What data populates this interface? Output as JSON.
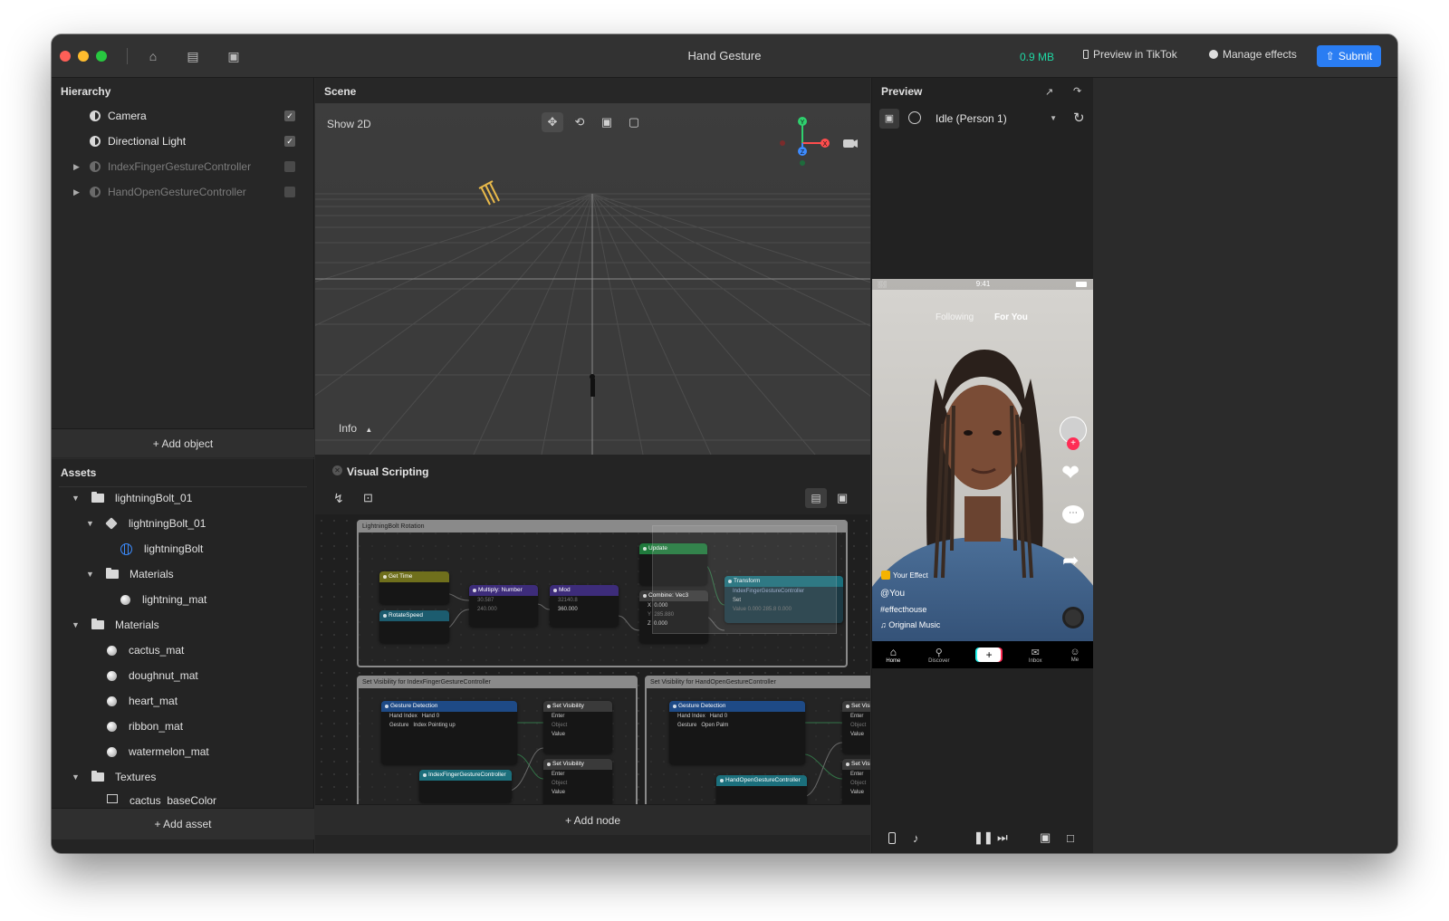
{
  "titlebar": {
    "title": "Hand Gesture",
    "memory": "0.9 MB",
    "preview_in_tiktok": "Preview in TikTok",
    "manage_effects": "Manage effects",
    "submit": "Submit"
  },
  "hierarchy": {
    "title": "Hierarchy",
    "items": [
      {
        "label": "Camera",
        "checked": true
      },
      {
        "label": "Directional Light",
        "checked": true
      },
      {
        "label": "IndexFingerGestureController",
        "checked": false
      },
      {
        "label": "HandOpenGestureController",
        "checked": false
      }
    ],
    "add_label": "+ Add object"
  },
  "assets": {
    "title": "Assets",
    "items": [
      {
        "label": "lightningBolt_01",
        "kind": "folder"
      },
      {
        "label": "lightningBolt_01",
        "kind": "model"
      },
      {
        "label": "lightningBolt",
        "kind": "mesh"
      },
      {
        "label": "Materials",
        "kind": "folder"
      },
      {
        "label": "lightning_mat",
        "kind": "material"
      },
      {
        "label": "Materials",
        "kind": "folder"
      },
      {
        "label": "cactus_mat",
        "kind": "material"
      },
      {
        "label": "doughnut_mat",
        "kind": "material"
      },
      {
        "label": "heart_mat",
        "kind": "material"
      },
      {
        "label": "ribbon_mat",
        "kind": "material"
      },
      {
        "label": "watermelon_mat",
        "kind": "material"
      },
      {
        "label": "Textures",
        "kind": "folder"
      },
      {
        "label": "cactus_baseColor",
        "kind": "texture"
      }
    ],
    "add_label": "+ Add asset"
  },
  "scene": {
    "title": "Scene",
    "show2d": "Show 2D",
    "info": "Info",
    "gizmo": {
      "y": "Y",
      "x": "X",
      "z": "Z"
    }
  },
  "visual_scripting": {
    "title": "Visual Scripting",
    "add_node": "+ Add node",
    "groups": {
      "rotation": "LightningBolt Rotation",
      "index": "Set Visibility for IndexFingerGestureController",
      "open": "Set Visibility for HandOpenGestureController"
    },
    "nodes": {
      "get_time": "Get Time",
      "rotate_speed": "RotateSpeed",
      "multiply": "Multiply: Number",
      "mul_a": "30.587",
      "mul_b": "240.000",
      "mod": "Mod",
      "mod_a": "32140.8",
      "mod_b": "360.000",
      "update": "Update",
      "combine": "Combine: Vec3",
      "cx": "0.000",
      "cy": "285.880",
      "cz": "0.000",
      "transform": "Transform",
      "transform_target": "IndexFingerGestureController",
      "set": "Set",
      "value_row": "Value  0.000  285.8  0.000",
      "gesture_detection": "Gesture Detection",
      "hand_index": "Hand Index",
      "hand0": "Hand 0",
      "gesture": "Gesture",
      "gesture_index": "Index Pointing up",
      "gesture_open": "Open Palm",
      "set_visibility": "Set Visibility",
      "enter": "Enter",
      "object": "Object",
      "value": "Value",
      "index_ctrl": "IndexFingerGestureController",
      "open_ctrl": "HandOpenGestureController"
    }
  },
  "preview": {
    "title": "Preview",
    "selected": "Idle (Person 1)",
    "phone": {
      "time": "9:41",
      "tab_following": "Following",
      "tab_foryou": "For You",
      "your_effect": "Your Effect",
      "user": "@You",
      "hashtag": "#effecthouse",
      "music": "Original Music",
      "nav": [
        "Home",
        "Discover",
        "",
        "Inbox",
        "Me"
      ]
    }
  },
  "colors": {
    "accent": "#2a7df3",
    "memory": "#1fd8a4"
  }
}
